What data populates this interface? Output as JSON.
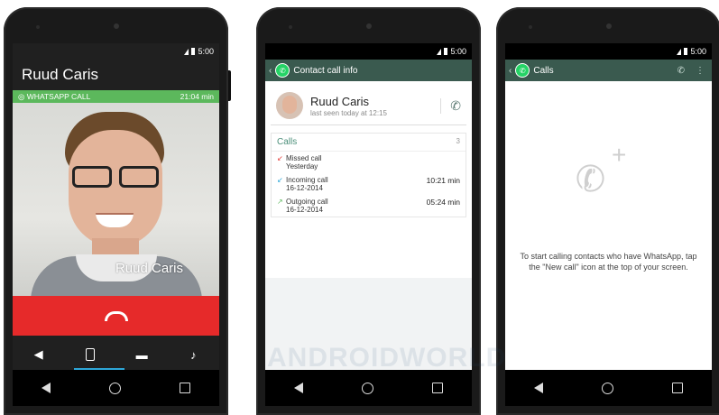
{
  "statusbar": {
    "time": "5:00"
  },
  "phone1": {
    "caller_name": "Ruud Caris",
    "banner_label": "WHATSAPP CALL",
    "banner_duration": "21:04 min",
    "photo_name": "Ruud Caris"
  },
  "phone2": {
    "title": "Contact call info",
    "contact_name": "Ruud Caris",
    "last_seen": "last seen today at 12:15",
    "calls_header": "Calls",
    "calls_count": "3",
    "calls": [
      {
        "type": "Missed call",
        "date": "Yesterday",
        "duration": ""
      },
      {
        "type": "Incoming call",
        "date": "16-12-2014",
        "duration": "10:21 min"
      },
      {
        "type": "Outgoing call",
        "date": "16-12-2014",
        "duration": "05:24 min"
      }
    ]
  },
  "phone3": {
    "title": "Calls",
    "empty_text": "To start calling contacts who have WhatsApp, tap the \"New call\" icon at the top of your screen."
  },
  "watermark": "ANDROIDWORLD",
  "colors": {
    "accent_green": "#5cb85c",
    "whatsapp_bar": "#3a5a4f",
    "hangup_red": "#e62a2a",
    "active_blue": "#2ea7d8"
  }
}
